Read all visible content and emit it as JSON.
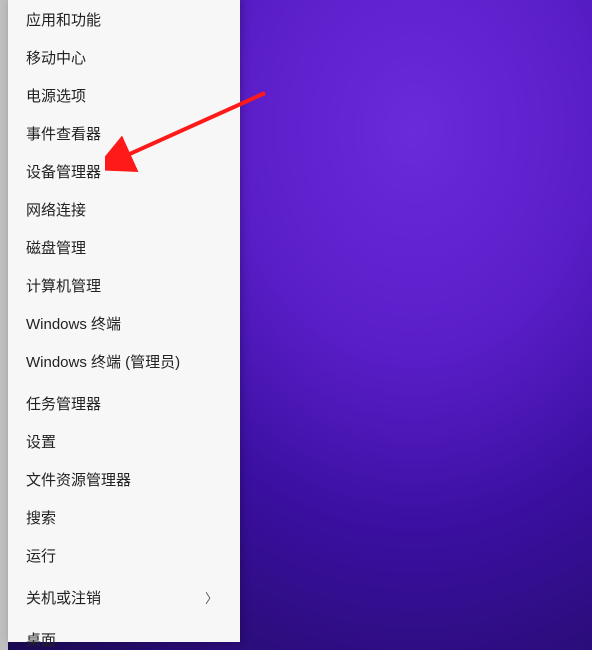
{
  "menu": {
    "groups": [
      [
        {
          "label": "应用和功能"
        },
        {
          "label": "移动中心"
        },
        {
          "label": "电源选项"
        },
        {
          "label": "事件查看器"
        },
        {
          "label": "设备管理器"
        },
        {
          "label": "网络连接"
        },
        {
          "label": "磁盘管理"
        },
        {
          "label": "计算机管理"
        },
        {
          "label": "Windows 终端"
        },
        {
          "label": "Windows 终端 (管理员)"
        }
      ],
      [
        {
          "label": "任务管理器"
        },
        {
          "label": "设置"
        },
        {
          "label": "文件资源管理器"
        },
        {
          "label": "搜索"
        },
        {
          "label": "运行"
        }
      ],
      [
        {
          "label": "关机或注销",
          "submenu": true
        }
      ],
      [
        {
          "label": "桌面"
        }
      ]
    ]
  },
  "annotation": {
    "points_to": "设备管理器"
  }
}
